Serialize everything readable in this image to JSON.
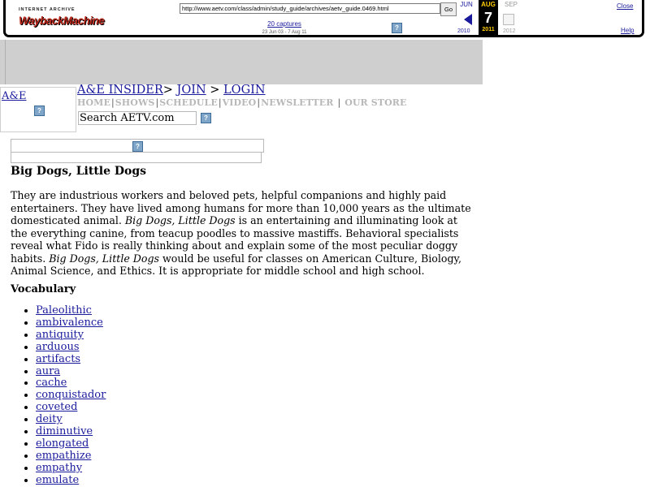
{
  "wayback": {
    "logo_top": "INTERNET ARCHIVE",
    "logo_main": "WaybackMachine",
    "url": "http://www.aetv.com/class/admin/study_guide/archives/aetv_guide.0469.html",
    "go_label": "Go",
    "captures": "20 captures",
    "date_range": "23 Jun 03 - 7 Aug 11",
    "prev_month": "JUN",
    "current_month": "AUG",
    "next_month": "SEP",
    "current_day": "7",
    "prev_year": "2010",
    "current_year": "2011",
    "next_year": "2012",
    "close_label": "Close",
    "help_label": "Help",
    "icon_glyph": "?"
  },
  "header": {
    "logo_text": "A&E",
    "icon_glyph": "?",
    "top_links": [
      "A&E INSIDER",
      "JOIN",
      "LOGIN"
    ],
    "top_separators": [
      ">",
      ">"
    ],
    "nav_items": [
      "HOME",
      "SHOWS",
      "SCHEDULE",
      "VIDEO",
      "NEWSLETTER",
      "OUR STORE"
    ],
    "nav_separator": "|",
    "search_placeholder": "Search AETV.com"
  },
  "article": {
    "title": "Big Dogs, Little Dogs",
    "intro": [
      {
        "text": "They are industrious workers and beloved pets, helpful companions and highly paid entertainers. They have lived among humans for more than 10,000 years as the ultimate domesticated animal. ",
        "italic": false
      },
      {
        "text": "Big Dogs, Little Dogs",
        "italic": true
      },
      {
        "text": " is an entertaining and illuminating look at the everything canine, from teacup poodles to massive mastiffs. Behavioral specialists reveal what Fido is really thinking about and explain some of the most peculiar doggy habits. ",
        "italic": false
      },
      {
        "text": "Big Dogs, Little Dogs",
        "italic": true
      },
      {
        "text": " would be useful for classes on American Culture, Biology, Animal Science, and Ethics. It is appropriate for middle school and high school.",
        "italic": false
      }
    ],
    "vocab_heading": "Vocabulary",
    "vocabulary": [
      "Paleolithic",
      "ambivalence",
      "antiquity",
      "arduous",
      "artifacts",
      "aura",
      "cache",
      "conquistador",
      "coveted",
      "deity",
      "diminutive",
      "elongated",
      "empathize",
      "empathy",
      "emulate"
    ]
  }
}
